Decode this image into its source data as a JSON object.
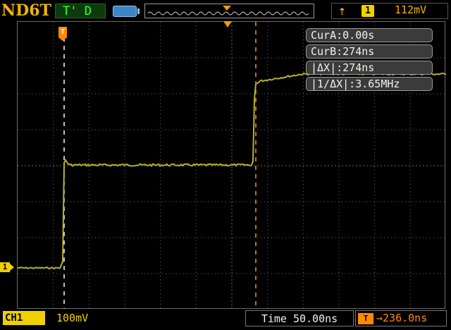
{
  "header": {
    "brand": "ND6T",
    "run_status": "T' D",
    "trigger": {
      "edge_icon": "rising-edge-icon",
      "source": "1",
      "level": "112mV"
    }
  },
  "cursors": {
    "rows": [
      "CurA:0.00s",
      "CurB:274ns",
      "|ΔX|:274ns",
      "|1/ΔX|:3.65MHz"
    ]
  },
  "markers": {
    "channel1": "1",
    "cursorA_tag": "T"
  },
  "footer": {
    "ch1_label": "CH1",
    "ch1_scale": "100mV",
    "timebase": "Time 50.00ns",
    "trig_pos_icon": "T",
    "trig_pos": "→236.0ns"
  },
  "colors": {
    "trace": "#b8b02a",
    "grid": "#7a7a7a",
    "brand": "#f0b400",
    "cursorA": "#ffffff",
    "cursorB": "#ff9a00",
    "status_bg": "#0b3b0b"
  }
}
